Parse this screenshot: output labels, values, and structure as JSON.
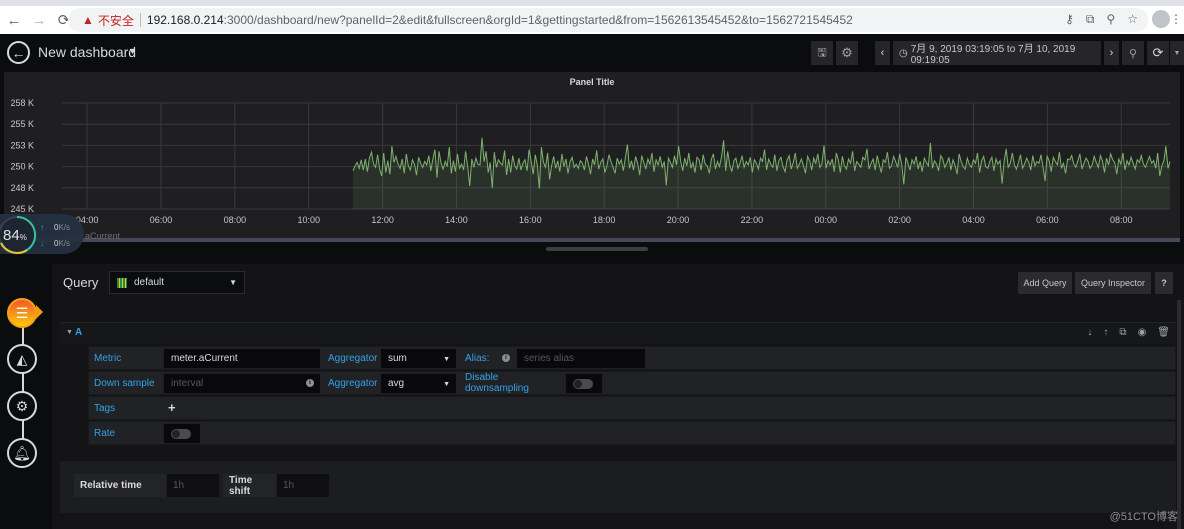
{
  "browser": {
    "security_warning": "不安全",
    "url_host": "192.168.0.214",
    "url_rest": ":3000/dashboard/new?panelId=2&edit&fullscreen&orgId=1&gettingstarted&from=1562613545452&to=1562721545452",
    "icons": [
      "back-arrow",
      "forward-arrow",
      "reload",
      "key",
      "translate",
      "zoom",
      "star",
      "profile",
      "menu"
    ]
  },
  "navbar": {
    "dashboard_title": "New dashboard",
    "time_range": "7月 9, 2019 03:19:05 to 7月 10, 2019 09:19:05",
    "icons": [
      "save",
      "settings",
      "time-back",
      "clock",
      "time-forward",
      "zoom-out",
      "refresh",
      "refresh-dropdown"
    ]
  },
  "panel": {
    "title": "Panel Title",
    "legend_series": "meter.aCurrent"
  },
  "net_widget": {
    "percent": "84",
    "percent_sign": "%",
    "upload": "0",
    "download": "0",
    "unit": "K/s"
  },
  "editor": {
    "query_label": "Query",
    "datasource": "default",
    "buttons": {
      "add_query": "Add Query",
      "query_inspector": "Query Inspector",
      "help": "?"
    },
    "query": {
      "ref_id": "A",
      "metric_label": "Metric",
      "metric_value": "meter.aCurrent",
      "aggregator_label": "Aggregator",
      "aggregator_value": "sum",
      "alias_label": "Alias:",
      "alias_placeholder": "series alias",
      "downsample_label": "Down sample",
      "downsample_placeholder": "interval",
      "ds_aggregator_label": "Aggregator",
      "ds_aggregator_value": "avg",
      "disable_downsampling_label": "Disable downsampling",
      "disable_downsampling": false,
      "tags_label": "Tags",
      "rate_label": "Rate",
      "rate": false
    },
    "options": {
      "relative_time_label": "Relative time",
      "relative_time_placeholder": "1h",
      "time_shift_label": "Time shift",
      "time_shift_placeholder": "1h"
    }
  },
  "watermark": "@51CTO博客",
  "colors": {
    "series": "#7eb26d",
    "accent": "#33a2e5",
    "active_step": "#f39c12"
  },
  "chart_data": {
    "type": "area",
    "title": "Panel Title",
    "xlabel": "",
    "ylabel": "",
    "x_ticks": [
      "04:00",
      "06:00",
      "08:00",
      "10:00",
      "12:00",
      "14:00",
      "16:00",
      "18:00",
      "20:00",
      "22:00",
      "00:00",
      "02:00",
      "04:00",
      "06:00",
      "08:00"
    ],
    "y_ticks": [
      "245 K",
      "248 K",
      "250 K",
      "253 K",
      "255 K",
      "258 K"
    ],
    "ylim": [
      245000,
      257500
    ],
    "x_range_hours": [
      3.32,
      33.32
    ],
    "grid": true,
    "legend": "bottom",
    "series": [
      {
        "name": "meter.aCurrent",
        "start_hour": 11.2,
        "end_hour": 33.32,
        "approx_mean": 250200,
        "approx_min": 247300,
        "approx_max": 253500,
        "values": [
          249500,
          250100,
          250500,
          249800,
          250800,
          249600,
          250900,
          249400,
          251000,
          251700,
          250300,
          249900,
          251400,
          249700,
          248900,
          251600,
          249300,
          250700,
          249100,
          252400,
          250500,
          251200,
          250300,
          249800,
          250900,
          249200,
          251500,
          250100,
          249600,
          250800,
          250300,
          249000,
          251100,
          250400,
          249900,
          250600,
          250200,
          251300,
          249500,
          250900,
          252000,
          248700,
          251800,
          250400,
          249700,
          250600,
          250000,
          252300,
          249200,
          250700,
          249400,
          251500,
          249800,
          250300,
          249600,
          251800,
          250000,
          247700,
          250900,
          249900,
          251000,
          250300,
          250200,
          253400,
          250600,
          251800,
          249300,
          250500,
          247500,
          251700,
          249900,
          250800,
          250400,
          250200,
          251900,
          249000,
          250900,
          249300,
          251300,
          250100,
          249700,
          251000,
          249600,
          250400,
          250800,
          249500,
          252000,
          250600,
          249100,
          251400,
          250200,
          247400,
          252300,
          250500,
          249900,
          251600,
          248500,
          250100,
          251200,
          249800,
          250700,
          249400,
          251500,
          250000,
          250900,
          249200,
          250600,
          251100,
          249900,
          250300,
          249800,
          250700,
          250400,
          249600,
          251200,
          250300,
          249100,
          250900,
          250200,
          251900,
          249700,
          250500,
          250900,
          249300,
          250100,
          251400,
          250600,
          249900,
          249200,
          251000,
          250300,
          250800,
          249500,
          251100,
          252600,
          249800,
          250700,
          249600,
          251200,
          250400,
          249000,
          251300,
          250500,
          249700,
          250900,
          250300,
          251600,
          249400,
          250800,
          250200,
          251200,
          249900,
          250600,
          247800,
          251000,
          250500,
          249900,
          251300,
          250200,
          252400,
          250700,
          249500,
          251000,
          250100,
          251600,
          249800,
          250500,
          249300,
          251100,
          250800,
          249600,
          251400,
          250300,
          250100,
          249200,
          250900,
          251500,
          249700,
          250600,
          250000,
          251200,
          253100,
          249500,
          251800,
          250200,
          249400,
          250700,
          251000,
          249800,
          250400,
          251300,
          249900,
          250600,
          250200,
          251100,
          249300,
          250800,
          250400,
          249700,
          251000,
          250600,
          252000,
          249600,
          250900,
          250300,
          249900,
          251400,
          249500,
          250700,
          251100,
          250000,
          249400,
          250800,
          251300,
          249700,
          250500,
          251600,
          249800,
          250300,
          250900,
          250100,
          249200,
          251200,
          250700,
          249600,
          251000,
          250400,
          251500,
          249900,
          250300,
          252500,
          249800,
          250700,
          250200,
          250900,
          249400,
          251600,
          250800,
          249300,
          251200,
          250100,
          249700,
          250900,
          250400,
          251800,
          249500,
          250600,
          250300,
          249900,
          251100,
          250800,
          252100,
          249700,
          250400,
          250900,
          249600,
          251300,
          250200,
          249300,
          250800,
          250500,
          251700,
          249800,
          250100,
          251200,
          250600,
          249900,
          251500,
          250200,
          247900,
          251100,
          250400,
          249600,
          250800,
          250300,
          251200,
          249700,
          250600,
          249400,
          251000,
          250500,
          250100,
          252800,
          249800,
          250700,
          250300,
          249500,
          251300,
          250900,
          249900,
          250400,
          251100,
          249600,
          250800,
          250200,
          249100,
          251500,
          250600,
          250000,
          249700,
          251000,
          250300,
          249900,
          250800,
          250400,
          251600,
          249300,
          250700,
          251200,
          250000,
          249800,
          250600,
          251100,
          249500,
          250900,
          250300,
          250700,
          248000,
          250600,
          252100,
          249900,
          250400,
          251600,
          250200,
          249700,
          250500,
          251400,
          249800,
          250300,
          251000,
          250500,
          249600,
          251300,
          250100,
          250600,
          250400,
          251400,
          249900,
          248300,
          251200,
          250700,
          249400,
          251100,
          250600,
          250200,
          251700,
          249800,
          250400,
          249200,
          250900,
          250800,
          251300,
          250300,
          249900,
          250700,
          251500,
          249700,
          250400,
          251000,
          250600,
          249800,
          250200,
          251200,
          250500,
          249900,
          251300,
          250700,
          249300,
          251000,
          250200,
          251500,
          250800,
          250500,
          249100,
          250900,
          250300,
          251600,
          249600,
          250700,
          250200,
          251100,
          250400,
          249700,
          250800,
          250500,
          251300,
          250300,
          249900,
          250600,
          251200,
          250400,
          250700,
          249800,
          251600,
          248900,
          250100,
          250700,
          252400,
          249800,
          250600
        ]
      }
    ]
  }
}
